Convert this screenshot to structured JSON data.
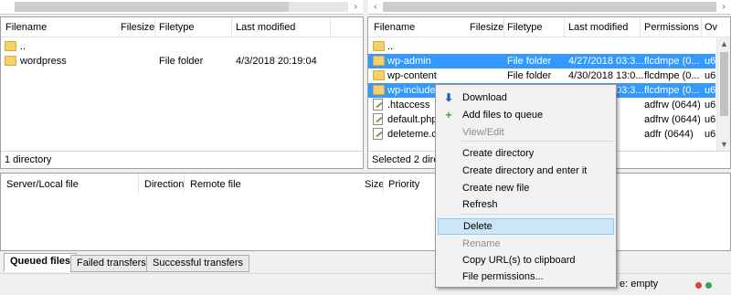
{
  "scrollbars": {
    "left_arrow": "‹",
    "right_arrow": "›"
  },
  "local": {
    "columns": [
      "Filename",
      "Filesize",
      "Filetype",
      "Last modified"
    ],
    "rows": [
      {
        "name": "..",
        "size": "",
        "type": "",
        "modified": ""
      },
      {
        "name": "wordpress",
        "size": "",
        "type": "File folder",
        "modified": "4/3/2018 20:19:04"
      }
    ],
    "status": "1 directory"
  },
  "remote": {
    "columns": [
      "Filename",
      "Filesize",
      "Filetype",
      "Last modified",
      "Permissions",
      "Ov"
    ],
    "rows": [
      {
        "name": "..",
        "type": "",
        "modified": "",
        "perms": "",
        "owner": "",
        "icon": "folder",
        "selected": false
      },
      {
        "name": "wp-admin",
        "type": "File folder",
        "modified": "4/27/2018 03:3...",
        "perms": "flcdmpe (0...",
        "owner": "u6",
        "icon": "folder",
        "selected": true
      },
      {
        "name": "wp-content",
        "type": "File folder",
        "modified": "4/30/2018 13:0...",
        "perms": "flcdmpe (0...",
        "owner": "u6",
        "icon": "folder",
        "selected": false
      },
      {
        "name": "wp-includes",
        "type": "File folder",
        "modified": "4/27/2018 03:3...",
        "perms": "flcdmpe (0...",
        "owner": "u6",
        "icon": "folder",
        "selected": true
      },
      {
        "name": ".htaccess",
        "type": "",
        "modified": "...",
        "perms": "adfrw (0644)",
        "owner": "u6",
        "icon": "file",
        "selected": false
      },
      {
        "name": "default.php",
        "type": "",
        "modified": "...1:...",
        "perms": "adfrw (0644)",
        "owner": "u6",
        "icon": "file",
        "selected": false
      },
      {
        "name": "deleteme.ch",
        "type": "",
        "modified": "...5:...",
        "perms": "adfr (0644)",
        "owner": "u6",
        "icon": "file",
        "selected": false
      }
    ],
    "status": "Selected 2 direc"
  },
  "queue": {
    "columns": [
      "Server/Local file",
      "Direction",
      "Remote file",
      "Size",
      "Priority"
    ]
  },
  "tabs": [
    "Queued files",
    "Failed transfers",
    "Successful transfers"
  ],
  "statusbar": {
    "queue_text": "e: empty"
  },
  "context_menu": {
    "items": [
      {
        "label": "Download",
        "icon": "download-arrow-icon",
        "glyph": "⬇",
        "disabled": false,
        "highlight": false
      },
      {
        "label": "Add files to queue",
        "icon": "add-to-queue-icon",
        "glyph": "+",
        "disabled": false,
        "highlight": false
      },
      {
        "label": "View/Edit",
        "disabled": true,
        "highlight": false
      },
      {
        "label": "Create directory",
        "disabled": false,
        "highlight": false
      },
      {
        "label": "Create directory and enter it",
        "disabled": false,
        "highlight": false
      },
      {
        "label": "Create new file",
        "disabled": false,
        "highlight": false
      },
      {
        "label": "Refresh",
        "disabled": false,
        "highlight": false
      },
      {
        "label": "Delete",
        "disabled": false,
        "highlight": true
      },
      {
        "label": "Rename",
        "disabled": true,
        "highlight": false
      },
      {
        "label": "Copy URL(s) to clipboard",
        "disabled": false,
        "highlight": false
      },
      {
        "label": "File permissions...",
        "disabled": false,
        "highlight": false
      }
    ]
  },
  "colors": {
    "selection": "#3399ff",
    "menu_highlight": "#cde6f7",
    "led_red": "#e04040",
    "led_green": "#2fa84f"
  }
}
